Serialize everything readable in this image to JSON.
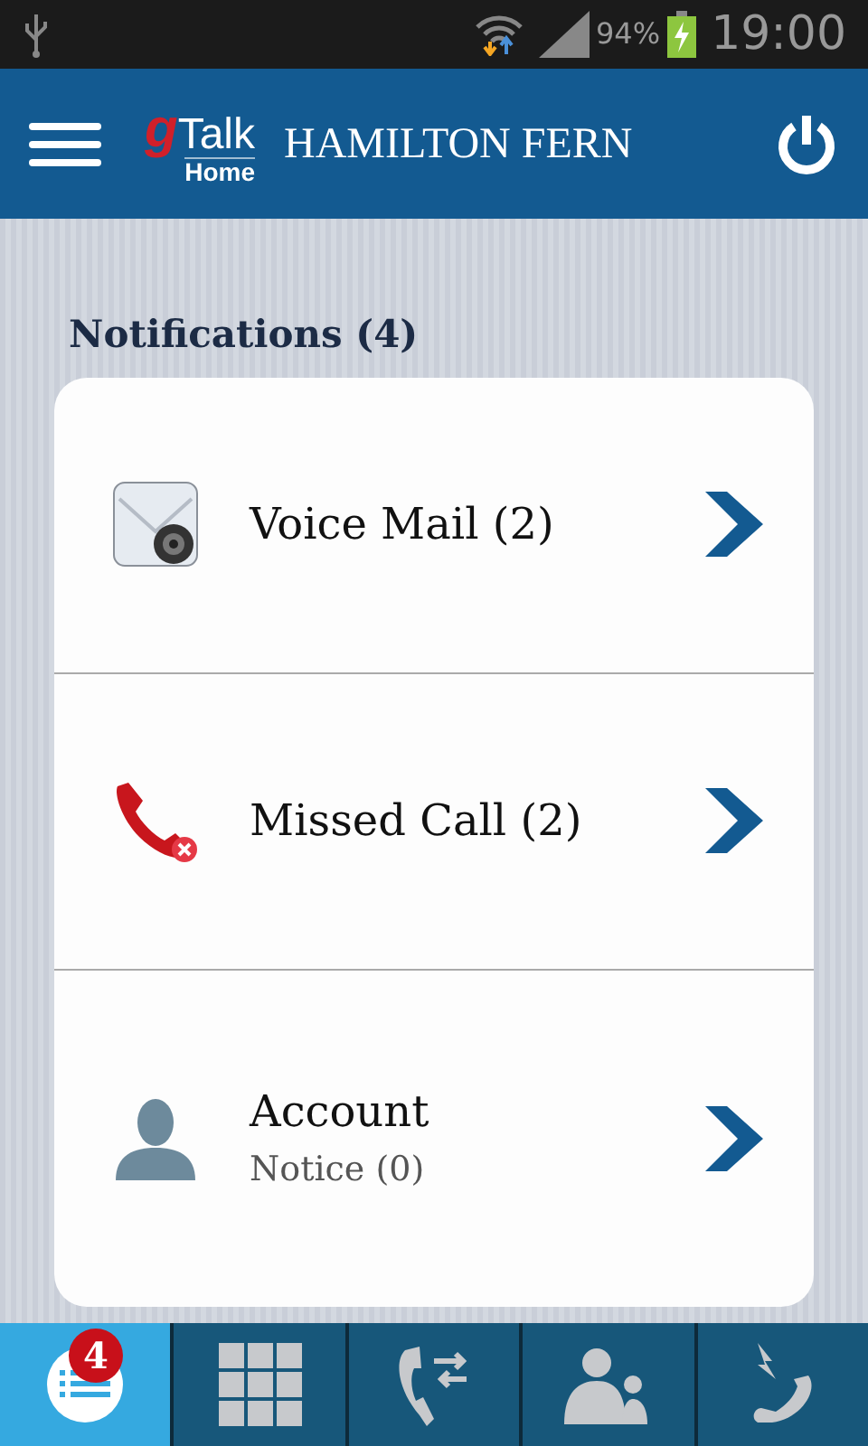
{
  "status_bar": {
    "battery": "94%",
    "time": "19:00"
  },
  "header": {
    "logo": {
      "letter": "g",
      "word": "Talk",
      "sub": "Home"
    },
    "title": "HAMILTON FERN"
  },
  "section_title": "Notifications (4)",
  "notifications": [
    {
      "kind": "voicemail",
      "label": "Voice Mail (2)"
    },
    {
      "kind": "missed",
      "label": "Missed Call (2)"
    },
    {
      "kind": "account",
      "label": "Account",
      "sub": "Notice (0)"
    }
  ],
  "tabs": [
    {
      "kind": "notifications",
      "selected": true,
      "badge": "4"
    },
    {
      "kind": "keypad",
      "selected": false
    },
    {
      "kind": "transfer",
      "selected": false
    },
    {
      "kind": "contacts",
      "selected": false
    },
    {
      "kind": "calls",
      "selected": false
    }
  ]
}
